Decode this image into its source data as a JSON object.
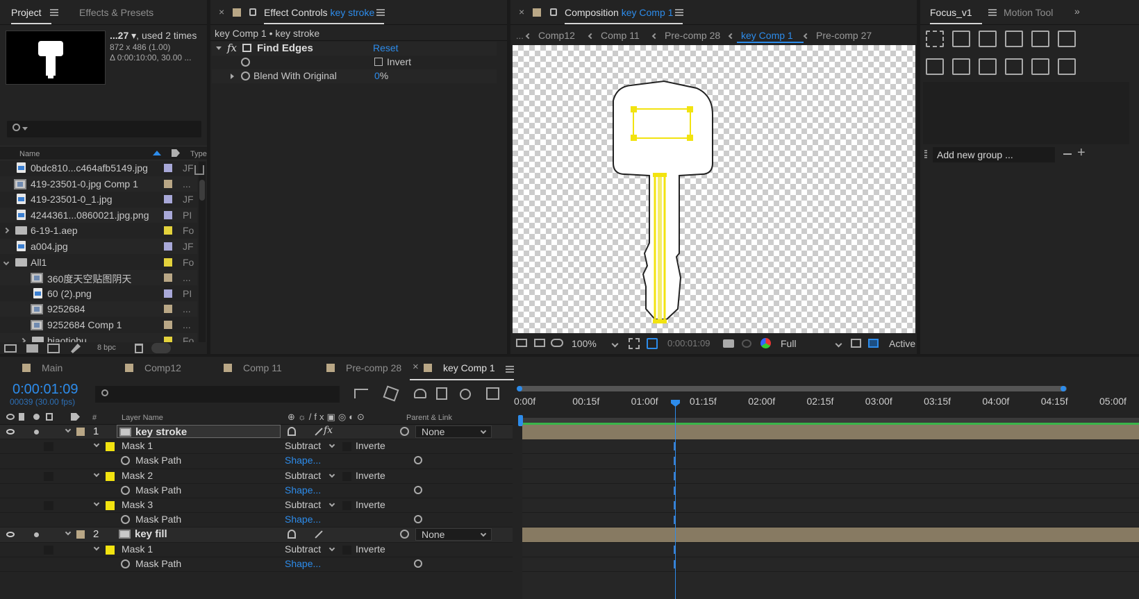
{
  "project": {
    "tab_label": "Project",
    "effects_tab_label": "Effects & Presets",
    "item_name": "...27 ▾",
    "used_text": ", used 2 times",
    "dimensions": "872 x 486 (1.00)",
    "duration": "Δ 0:00:10:00, 30.00 ...",
    "search_placeholder": "",
    "col_name": "Name",
    "col_type": "Type",
    "bpc": "8 bpc",
    "items": [
      {
        "name": "0bdc810...c464afb5149.jpg",
        "type": "JF",
        "kind": "file",
        "indent": 0,
        "color": "#a8a8d8"
      },
      {
        "name": "419-23501-0.jpg Comp 1",
        "type": "...",
        "kind": "comp",
        "indent": 0,
        "color": "#b9a786"
      },
      {
        "name": "419-23501-0_1.jpg",
        "type": "JF",
        "kind": "file",
        "indent": 0,
        "color": "#a8a8d8"
      },
      {
        "name": "4244361...0860021.jpg.png",
        "type": "PI",
        "kind": "file",
        "indent": 0,
        "color": "#a8a8d8"
      },
      {
        "name": "6-19-1.aep",
        "type": "Fo",
        "kind": "folder",
        "indent": 0,
        "color": "#e3d23c"
      },
      {
        "name": "a004.jpg",
        "type": "JF",
        "kind": "file",
        "indent": 0,
        "color": "#a8a8d8"
      },
      {
        "name": "All1",
        "type": "Fo",
        "kind": "folder",
        "indent": 0,
        "color": "#e3d23c"
      },
      {
        "name": "360度天空贴图阴天",
        "type": "...",
        "kind": "comp",
        "indent": 1,
        "color": "#b9a786"
      },
      {
        "name": "60 (2).png",
        "type": "PI",
        "kind": "file",
        "indent": 1,
        "color": "#a8a8d8"
      },
      {
        "name": "9252684",
        "type": "...",
        "kind": "comp",
        "indent": 1,
        "color": "#b9a786"
      },
      {
        "name": "9252684 Comp 1",
        "type": "...",
        "kind": "comp",
        "indent": 1,
        "color": "#b9a786"
      },
      {
        "name": "biaotiobu",
        "type": "Fo",
        "kind": "folder",
        "indent": 1,
        "color": "#e3d23c"
      }
    ]
  },
  "effect_controls": {
    "tab_prefix": "Effect Controls",
    "tab_layer": "key stroke",
    "breadcrumb": "key Comp 1 • key stroke",
    "effect_name": "Find Edges",
    "reset": "Reset",
    "invert_label": "Invert",
    "blend_label": "Blend With Original",
    "blend_value": "0",
    "blend_unit": "%"
  },
  "composition": {
    "tab_prefix": "Composition",
    "tab_comp": "key Comp 1",
    "crumbs": [
      "Comp12",
      "Comp 11",
      "Pre-comp 28",
      "key Comp 1",
      "Pre-comp 27"
    ],
    "active_crumb": "key Comp 1",
    "zoom": "100%",
    "timecode": "0:00:01:09",
    "resolution": "Full",
    "camera": "Active"
  },
  "focus": {
    "tab_label": "Focus_v1",
    "motion_tab": "Motion Tool",
    "add_group": "Add new group ..."
  },
  "timeline": {
    "tabs": [
      "Main",
      "Comp12",
      "Comp 11",
      "Pre-comp 28",
      "key Comp 1"
    ],
    "active_tab": "key Comp 1",
    "timecode": "0:00:01:09",
    "frame_info": "00039 (30.00 fps)",
    "col_layer_name": "Layer Name",
    "col_parent": "Parent & Link",
    "ruler": [
      "0:00f",
      "00:15f",
      "01:00f",
      "01:15f",
      "02:00f",
      "02:15f",
      "03:00f",
      "03:15f",
      "04:00f",
      "04:15f",
      "05:00f"
    ],
    "layers": [
      {
        "num": "1",
        "name": "key stroke",
        "parent": "None"
      },
      {
        "num": "2",
        "name": "key fill",
        "parent": "None"
      }
    ],
    "masks_layer1": [
      "Mask 1",
      "Mask 2",
      "Mask 3"
    ],
    "masks_layer2": [
      "Mask 1"
    ],
    "mask_mode": "Subtract",
    "inverted_label": "Inverte",
    "mask_path_label": "Mask Path",
    "shape_label": "Shape..."
  },
  "colors": {
    "accent": "#2d8ceb",
    "mask_yellow": "#f2e310",
    "layer_bar": "#877a62",
    "work_area": "#39b54a"
  }
}
